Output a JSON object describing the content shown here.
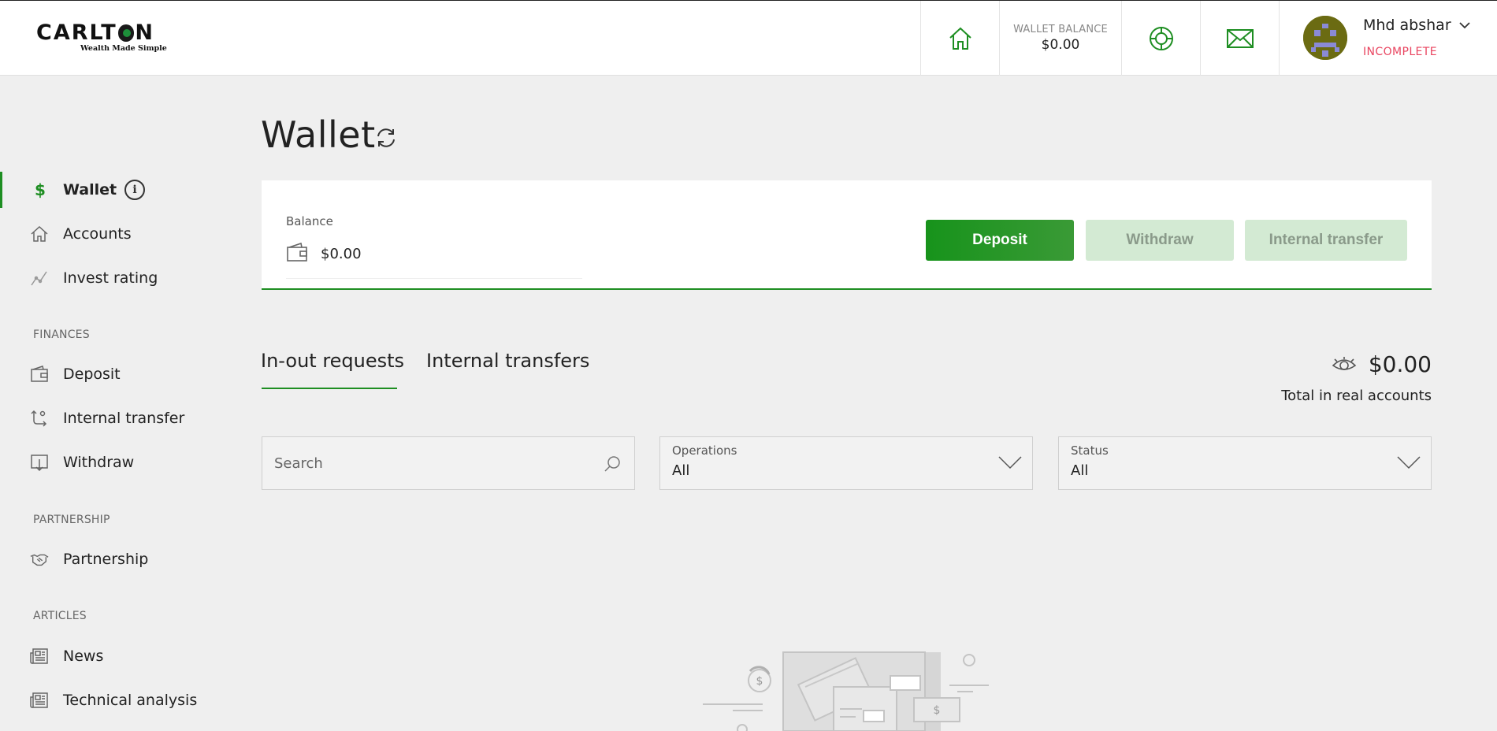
{
  "header": {
    "logo_text_pre": "CARLT",
    "logo_text_post": "N",
    "logo_tagline": "Wealth Made Simple",
    "wallet_balance_label": "WALLET BALANCE",
    "wallet_balance_value": "$0.00",
    "user_name": "Mhd abshar",
    "user_status": "INCOMPLETE"
  },
  "sidebar": {
    "items_main": [
      {
        "label": "Wallet",
        "icon": "dollar-icon",
        "active": true
      },
      {
        "label": "Accounts",
        "icon": "home-icon"
      },
      {
        "label": "Invest rating",
        "icon": "trend-icon"
      }
    ],
    "finances_title": "FINANCES",
    "finances": [
      {
        "label": "Deposit",
        "icon": "wallet-icon"
      },
      {
        "label": "Internal transfer",
        "icon": "transfer-icon"
      },
      {
        "label": "Withdraw",
        "icon": "withdraw-icon"
      }
    ],
    "partnership_title": "PARTNERSHIP",
    "partnership": [
      {
        "label": "Partnership",
        "icon": "handshake-icon"
      }
    ],
    "articles_title": "ARTICLES",
    "articles": [
      {
        "label": "News",
        "icon": "newspaper-icon"
      },
      {
        "label": "Technical analysis",
        "icon": "newspaper-icon"
      }
    ]
  },
  "main": {
    "title": "Wallet",
    "balance_label": "Balance",
    "balance_value": "$0.00",
    "deposit_label": "Deposit",
    "withdraw_label": "Withdraw",
    "internal_transfer_label": "Internal transfer",
    "tabs": [
      {
        "label": "In-out requests",
        "active": true
      },
      {
        "label": "Internal transfers"
      }
    ],
    "total_value": "$0.00",
    "total_label": "Total in real accounts",
    "search_placeholder": "Search",
    "operations_label": "Operations",
    "operations_value": "All",
    "status_label": "Status",
    "status_value": "All"
  },
  "colors": {
    "accent": "#1e8e22",
    "status_incomplete": "#e94560",
    "disabled_button": "#d3ead3"
  }
}
